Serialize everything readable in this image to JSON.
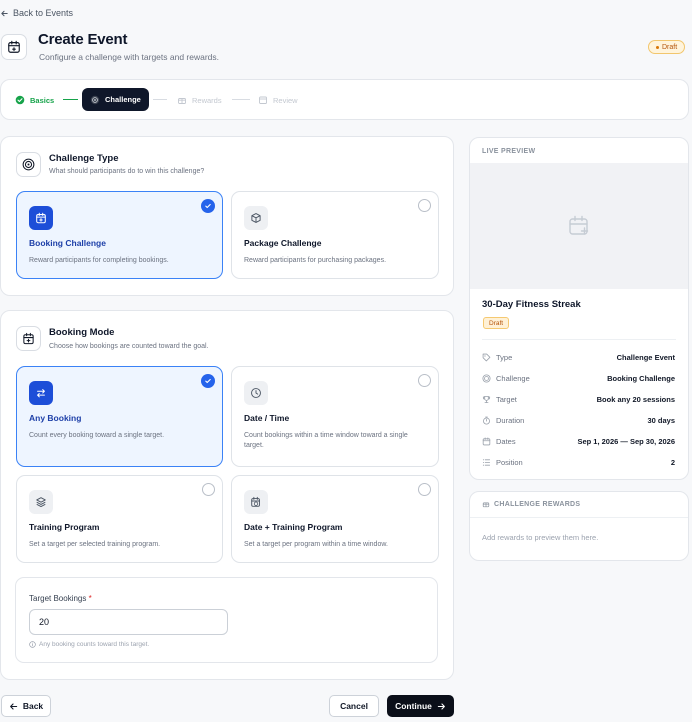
{
  "header": {
    "back_link": "Back to Events",
    "title": "Create Event",
    "subtitle": "Configure a challenge with targets and rewards.",
    "status_badge": "Draft"
  },
  "steps": [
    {
      "label": "Basics",
      "state": "done",
      "icon": "check-circle-icon"
    },
    {
      "label": "Challenge",
      "state": "active",
      "icon": "target-icon"
    },
    {
      "label": "Rewards",
      "state": "upcoming",
      "icon": "gift-icon"
    },
    {
      "label": "Review",
      "state": "upcoming",
      "icon": "calendar-icon"
    }
  ],
  "challenge_type": {
    "title": "Challenge Type",
    "subtitle": "What should participants do to win this challenge?",
    "options": [
      {
        "title": "Booking Challenge",
        "desc": "Reward participants for completing bookings.",
        "selected": true,
        "icon": "calendar-plus-icon"
      },
      {
        "title": "Package Challenge",
        "desc": "Reward participants for purchasing packages.",
        "selected": false,
        "icon": "package-icon"
      }
    ]
  },
  "booking_mode": {
    "title": "Booking Mode",
    "subtitle": "Choose how bookings are counted toward the goal.",
    "options": [
      {
        "title": "Any Booking",
        "desc": "Count every booking toward a single target.",
        "selected": true,
        "icon": "swap-icon"
      },
      {
        "title": "Date / Time",
        "desc": "Count bookings within a time window toward a single target.",
        "selected": false,
        "icon": "clock-icon"
      },
      {
        "title": "Training Program",
        "desc": "Set a target per selected training program.",
        "selected": false,
        "icon": "layers-icon"
      },
      {
        "title": "Date + Training Program",
        "desc": "Set a target per program within a time window.",
        "selected": false,
        "icon": "calendar-clock-icon"
      }
    ]
  },
  "target": {
    "label": "Target Bookings",
    "required_mark": "*",
    "value": "20",
    "hint": "Any booking counts toward this target."
  },
  "actions": {
    "back": "Back",
    "cancel": "Cancel",
    "continue": "Continue"
  },
  "preview": {
    "heading": "LIVE PREVIEW",
    "event_title": "30-Day Fitness Streak",
    "badge": "Draft",
    "rows": [
      {
        "key": "Type",
        "value": "Challenge Event",
        "icon": "tag-icon"
      },
      {
        "key": "Challenge",
        "value": "Booking Challenge",
        "icon": "target-icon"
      },
      {
        "key": "Target",
        "value": "Book any 20 sessions",
        "icon": "trophy-icon"
      },
      {
        "key": "Duration",
        "value": "30 days",
        "icon": "stopwatch-icon"
      },
      {
        "key": "Dates",
        "value": "Sep 1, 2026 — Sep 30, 2026",
        "icon": "calendar-icon"
      },
      {
        "key": "Position",
        "value": "2",
        "icon": "list-icon"
      }
    ]
  },
  "rewards": {
    "heading": "CHALLENGE REWARDS",
    "empty": "Add rewards to preview them here."
  },
  "colors": {
    "accent": "#2563eb",
    "selected_bg": "#eef5ff",
    "dark": "#0f172a",
    "success": "#16a34a",
    "draft": "#b45309"
  }
}
